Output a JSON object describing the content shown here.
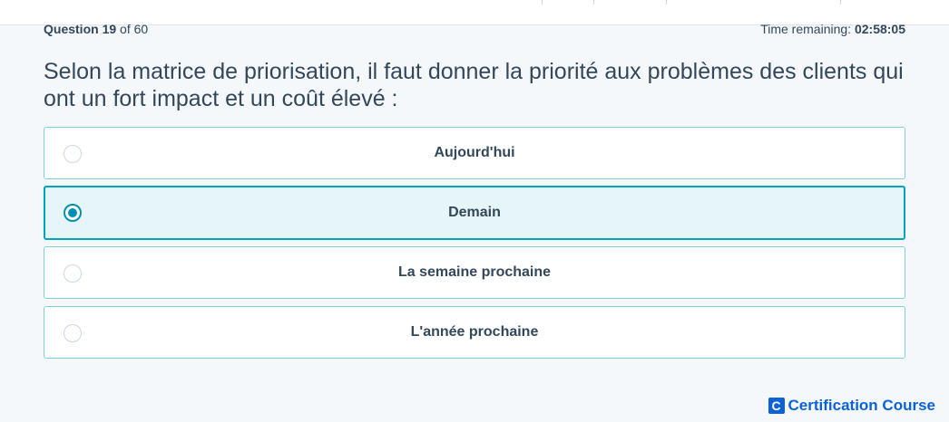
{
  "header": {
    "question_prefix": "Question",
    "question_number": "19",
    "question_total_text": "of 60",
    "time_label": "Time remaining:",
    "time_value": "02:58:05"
  },
  "question": {
    "text": "Selon la matrice de priorisation, il faut donner la priorité aux problèmes des clients qui ont un fort impact et un coût élevé :"
  },
  "options": [
    {
      "label": "Aujourd'hui",
      "selected": false
    },
    {
      "label": "Demain",
      "selected": true
    },
    {
      "label": "La semaine prochaine",
      "selected": false
    },
    {
      "label": "L'année prochaine",
      "selected": false
    }
  ],
  "brand": {
    "logo_letter": "C",
    "name": "Certification Course",
    "color": "#0b62d6"
  },
  "colors": {
    "accent": "#00a4bd",
    "selected_bg": "#e5f5f8",
    "text": "#33475b"
  }
}
